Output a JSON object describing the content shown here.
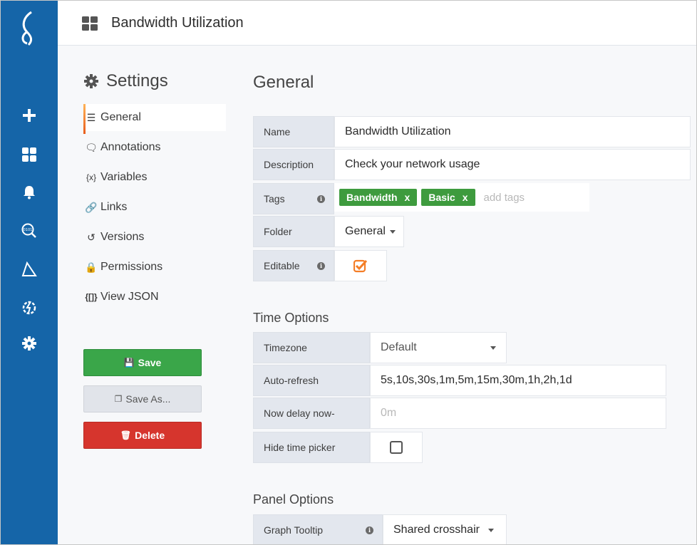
{
  "dashboard": {
    "title": "Bandwidth Utilization"
  },
  "menu": {
    "heading": "Settings",
    "items": [
      {
        "label": "General",
        "icon": "sliders-icon"
      },
      {
        "label": "Annotations",
        "icon": "comment-icon"
      },
      {
        "label": "Variables",
        "icon": "variable-icon"
      },
      {
        "label": "Links",
        "icon": "link-icon"
      },
      {
        "label": "Versions",
        "icon": "history-icon"
      },
      {
        "label": "Permissions",
        "icon": "lock-icon"
      },
      {
        "label": "View JSON",
        "icon": "json-icon"
      }
    ],
    "save_label": "Save",
    "save_as_label": "Save As...",
    "delete_label": "Delete"
  },
  "general": {
    "title": "General",
    "name_label": "Name",
    "name_value": "Bandwidth Utilization",
    "description_label": "Description",
    "description_value": "Check your network usage",
    "tags_label": "Tags",
    "tags": [
      "Bandwidth",
      "Basic"
    ],
    "tag_remove": "x",
    "tags_placeholder": "add tags",
    "folder_label": "Folder",
    "folder_value": "General",
    "editable_label": "Editable",
    "editable_checked": true
  },
  "time_options": {
    "title": "Time Options",
    "timezone_label": "Timezone",
    "timezone_value": "Default",
    "autorefresh_label": "Auto-refresh",
    "autorefresh_value": "5s,10s,30s,1m,5m,15m,30m,1h,2h,1d",
    "nowdelay_label": "Now delay now-",
    "nowdelay_placeholder": "0m",
    "hidepicker_label": "Hide time picker",
    "hidepicker_checked": false
  },
  "panel_options": {
    "title": "Panel Options",
    "graph_tooltip_label": "Graph Tooltip",
    "graph_tooltip_value": "Shared crosshair"
  },
  "colors": {
    "sidebar": "#1565a8",
    "save": "#3aa649",
    "delete": "#d6352d",
    "tag": "#3e9b3e",
    "active_accent": "#f47e27"
  }
}
